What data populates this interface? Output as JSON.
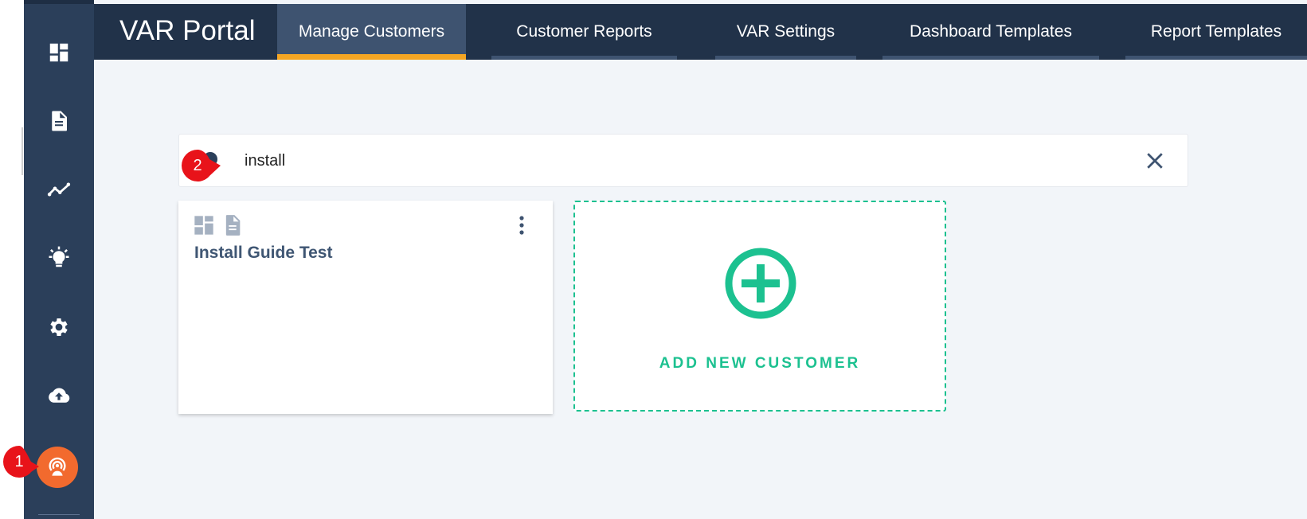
{
  "app": {
    "title": "VAR Portal"
  },
  "tabs": [
    {
      "label": "Manage Customers",
      "active": true
    },
    {
      "label": "Customer Reports",
      "active": false
    },
    {
      "label": "VAR Settings",
      "active": false
    },
    {
      "label": "Dashboard Templates",
      "active": false
    },
    {
      "label": "Report Templates",
      "active": false
    }
  ],
  "sidebar": {
    "icons": [
      "dashboard-icon",
      "document-icon",
      "trend-line-icon",
      "lightbulb-icon",
      "gear-icon",
      "cloud-upload-icon",
      "broadcast-icon"
    ]
  },
  "search": {
    "value": "install"
  },
  "customers": [
    {
      "name": "Install Guide Test"
    }
  ],
  "add_customer": {
    "label": "ADD NEW CUSTOMER"
  },
  "callouts": [
    {
      "number": "1"
    },
    {
      "number": "2"
    }
  ],
  "colors": {
    "sidebar": "#2b3f5a",
    "topbar": "#213249",
    "active_tab_underline": "#f5a623",
    "accent_green": "#1cc190",
    "broadcast_orange": "#f26a2e",
    "callout_red": "#e8131a"
  }
}
